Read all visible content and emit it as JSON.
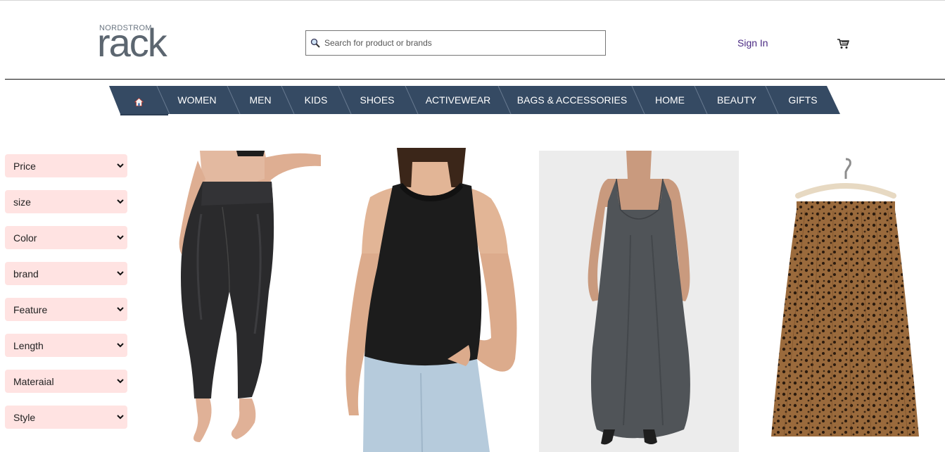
{
  "brand": {
    "super": "NORDSTROM",
    "name": "rack"
  },
  "search": {
    "placeholder": "Search for product or brands",
    "icon": "magnifier-icon"
  },
  "account": {
    "signin_label": "Sign In",
    "signin_color": "#4b2a83",
    "cart_icon": "cart-icon"
  },
  "nav": {
    "color": "#354a63",
    "home_icon": "home-icon",
    "items": [
      {
        "label": "WOMEN"
      },
      {
        "label": "MEN"
      },
      {
        "label": "KIDS"
      },
      {
        "label": "SHOES"
      },
      {
        "label": "ACTIVEWEAR"
      },
      {
        "label": "BAGS & ACCESSORIES"
      },
      {
        "label": "HOME"
      },
      {
        "label": "BEAUTY"
      },
      {
        "label": "GIFTS"
      }
    ]
  },
  "filters": {
    "background": "#ffe3e2",
    "items": [
      {
        "label": "Price"
      },
      {
        "label": "size"
      },
      {
        "label": "Color"
      },
      {
        "label": "brand"
      },
      {
        "label": "Feature"
      },
      {
        "label": "Length"
      },
      {
        "label": "Materaial"
      },
      {
        "label": "Style"
      }
    ]
  },
  "products": [
    {
      "kind": "black faux-leather leggings"
    },
    {
      "kind": "black halter tank top with jeans"
    },
    {
      "kind": "charcoal maxi slip dress"
    },
    {
      "kind": "leopard print pleated midi skirt"
    }
  ]
}
